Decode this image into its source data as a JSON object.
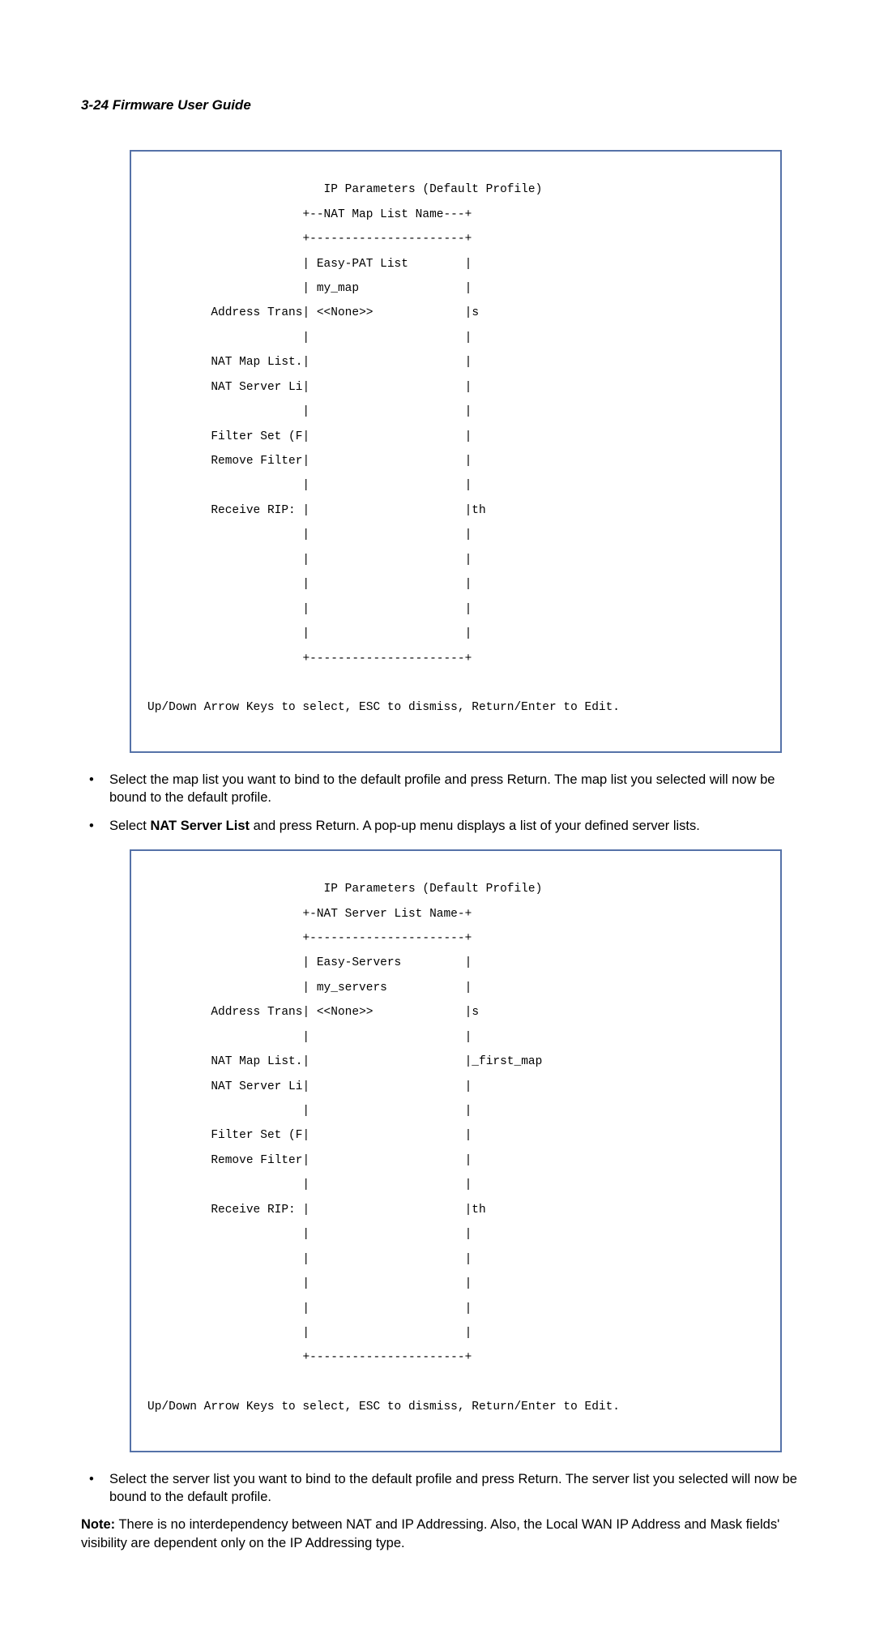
{
  "header": {
    "page_ref": "3-24",
    "title": "Firmware User Guide"
  },
  "terminal1": {
    "title": "IP Parameters (Default Profile)",
    "popup_title": "+--NAT Map List Name---+",
    "top_border": "+----------------------+",
    "items": {
      "i1": "Easy-PAT List",
      "i2": "my_map",
      "i3": "<<None>>"
    },
    "left": {
      "address": "Address Trans",
      "map": "NAT Map List.",
      "server": "NAT Server Li",
      "filter": "Filter Set (F",
      "remove": "Remove Filter",
      "rip": "Receive RIP:"
    },
    "right": {
      "s": "s",
      "th": "th"
    },
    "bottom_border": "+----------------------+",
    "help": "Up/Down Arrow Keys to select, ESC to dismiss, Return/Enter to Edit."
  },
  "bullets1": {
    "b1": "Select the map list you want to bind to the default profile and press Return. The map list you selected will now be bound to the default profile.",
    "b2_pre": "Select ",
    "b2_bold": "NAT Server List",
    "b2_post": " and press Return. A pop-up menu displays a list of your defined server lists."
  },
  "terminal2": {
    "title": "IP Parameters (Default Profile)",
    "popup_title": "+-NAT Server List Name-+",
    "top_border": "+----------------------+",
    "items": {
      "i1": "Easy-Servers",
      "i2": "my_servers",
      "i3": "<<None>>"
    },
    "left": {
      "address": "Address Trans",
      "map": "NAT Map List.",
      "server": "NAT Server Li",
      "filter": "Filter Set (F",
      "remove": "Remove Filter",
      "rip": "Receive RIP:"
    },
    "right": {
      "s": "s",
      "first": "_first_map",
      "th": "th"
    },
    "bottom_border": "+----------------------+",
    "help": "Up/Down Arrow Keys to select, ESC to dismiss, Return/Enter to Edit."
  },
  "bullets2": {
    "b1": "Select the server list you want to bind to the default profile and press Return. The server list you selected will now be bound to the default profile."
  },
  "note": {
    "label": "Note:",
    "text": " There is no interdependency between NAT and IP Addressing. Also, the Local WAN IP Address and Mask fields' visibility are dependent only on the IP Addressing type."
  }
}
